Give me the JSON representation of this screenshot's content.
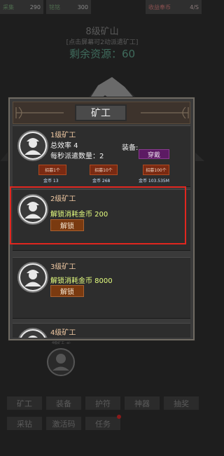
{
  "topbar": {
    "s1_label": "采集",
    "s1_value": "290",
    "s2_label": "铭铭",
    "s2_value": "300",
    "s3_label": "收益奉币",
    "s3_value": "4/S"
  },
  "mine": {
    "title": "8级矿山",
    "hint": "[点击屏幕可2动派遣矿工]",
    "resource_label": "剩余资源：",
    "resource_value": "60"
  },
  "modal": {
    "title": "矿工",
    "miners": [
      {
        "level": "1级矿工",
        "efficiency_label": "总效率 4",
        "equip_label": "装备:",
        "wear_button": "穿戴",
        "dispatch_label": "每秒派遣数量：2",
        "hire": [
          {
            "label": "招募1个",
            "cost": "金币 13"
          },
          {
            "label": "招募10个",
            "cost": "金币 268"
          },
          {
            "label": "招募100个",
            "cost": "金币 103.535M"
          }
        ]
      },
      {
        "level": "2级矿工",
        "unlock_text": "解锁消耗金币 200",
        "unlock_button": "解锁"
      },
      {
        "level": "3级矿工",
        "unlock_text": "解锁消耗金币 8000",
        "unlock_button": "解锁"
      },
      {
        "level": "4级矿工"
      }
    ]
  },
  "bottom_nav": {
    "row1": [
      "矿工",
      "装备",
      "护符",
      "神器",
      "抽奖"
    ],
    "row2": [
      "采钻",
      "激活码",
      "任务"
    ]
  },
  "colors": {
    "highlight": "#e0261f",
    "wear_button": "#5c1a63",
    "hire_button": "#7a2a12",
    "unlock_text": "#e6ff80"
  },
  "icons": [
    "miner-avatar-icon",
    "red-notification-dot"
  ]
}
